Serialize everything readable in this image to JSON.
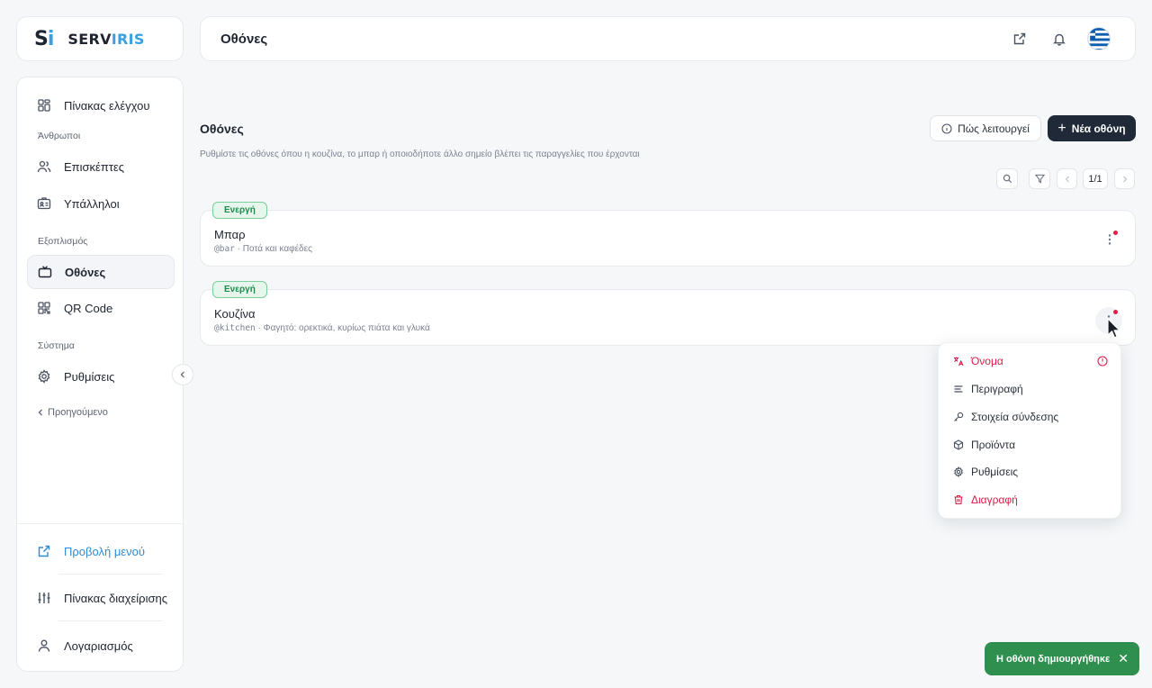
{
  "brand": {
    "mark_s": "S",
    "mark_i": "i",
    "name_part1": "SERV",
    "name_part2": "IRIS",
    "accent_color": "#3aa0e0"
  },
  "sidebar": {
    "dashboard": "Πίνακας ελέγχου",
    "section_people": "Άνθρωποι",
    "guests": "Επισκέπτες",
    "employees": "Υπάλληλοι",
    "section_equipment": "Εξοπλισμός",
    "screens": "Οθόνες",
    "qr_code": "QR Code",
    "section_system": "Σύστημα",
    "settings": "Ρυθμίσεις",
    "previous": "Προηγούμενο",
    "view_menu": "Προβολή μενού",
    "admin_panel": "Πίνακας διαχείρισης",
    "account": "Λογαριασμός"
  },
  "topbar": {
    "title": "Οθόνες",
    "icons": [
      "external-link-icon",
      "bell-icon",
      "greek-flag"
    ]
  },
  "page": {
    "title": "Οθόνες",
    "description": "Ρυθμίστε τις οθόνες όπου η κουζίνα, το μπαρ ή οποιοδήποτε άλλο σημείο βλέπει τις παραγγελίες που έρχονται",
    "how_it_works": "Πώς λειτουργεί",
    "new_screen": "Νέα οθόνη",
    "new_screen_plus": "+",
    "pagination": "1/1"
  },
  "screens": [
    {
      "status": "Ενεργή",
      "name": "Μπαρ",
      "handle": "@bar",
      "separator": " · ",
      "description": "Ποτά και καφέδες"
    },
    {
      "status": "Ενεργή",
      "name": "Κουζίνα",
      "handle": "@kitchen",
      "separator": " · ",
      "description": "Φαγητό: ορεκτικά, κυρίως πιάτα και γλυκά"
    }
  ],
  "context_menu": {
    "name": "Όνομα",
    "description": "Περιγραφή",
    "connection": "Στοιχεία σύνδεσης",
    "products": "Προϊόντα",
    "settings": "Ρυθμίσεις",
    "delete": "Διαγραφή"
  },
  "toast": {
    "message": "Η οθόνη δημιουργήθηκε",
    "close": "✕"
  },
  "colors": {
    "primary_dark": "#1f2937",
    "success": "#2e8f4f",
    "danger": "#d61e48",
    "link": "#2f8bd6"
  }
}
